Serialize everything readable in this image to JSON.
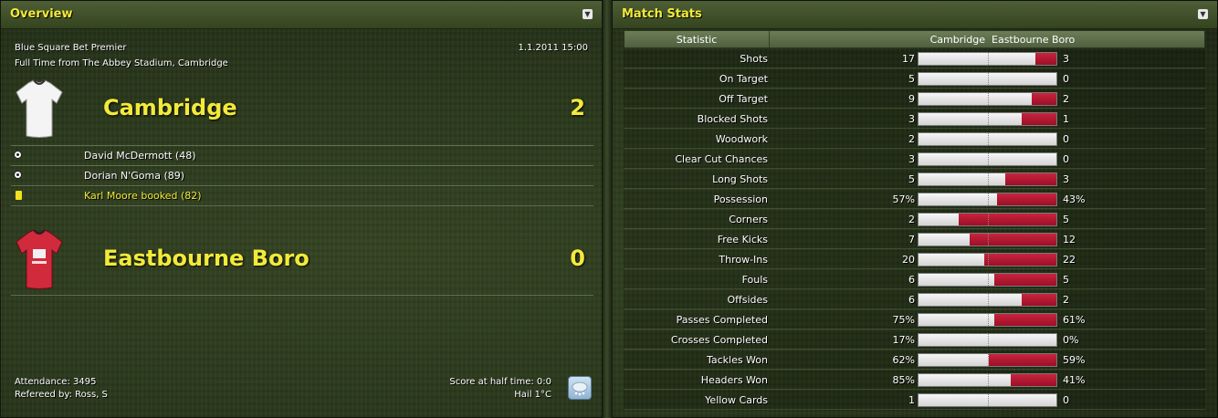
{
  "overview": {
    "title": "Overview",
    "competition": "Blue Square Bet Premier",
    "datetime": "1.1.2011 15:00",
    "venue": "Full Time from The Abbey Stadium, Cambridge",
    "home": {
      "name": "Cambridge",
      "score": "2",
      "shirt_color": "#ffffff"
    },
    "away": {
      "name": "Eastbourne Boro",
      "score": "0",
      "shirt_color": "#d4283a"
    },
    "events": [
      {
        "icon": "ball-icon",
        "text": "David McDermott (48)",
        "color": "#ffffff"
      },
      {
        "icon": "ball-icon",
        "text": "Dorian N'Goma (89)",
        "color": "#ffffff"
      },
      {
        "icon": "yellow-card-icon",
        "text": "Karl Moore booked (82)",
        "color": "#f2ea3a"
      }
    ],
    "attendance": "Attendance: 3495",
    "referee": "Refereed by: Ross, S",
    "halftime": "Score at half time: 0:0",
    "weather": "Hail 1°C",
    "weather_icon": "hail-icon"
  },
  "stats": {
    "title": "Match Stats",
    "header": {
      "statistic": "Statistic",
      "home": "Cambridge",
      "away": "Eastbourne Boro"
    },
    "rows": [
      {
        "label": "Shots",
        "home": "17",
        "away": "3",
        "home_frac": 0.85
      },
      {
        "label": "On Target",
        "home": "5",
        "away": "0",
        "home_frac": 1.0
      },
      {
        "label": "Off Target",
        "home": "9",
        "away": "2",
        "home_frac": 0.82
      },
      {
        "label": "Blocked Shots",
        "home": "3",
        "away": "1",
        "home_frac": 0.75
      },
      {
        "label": "Woodwork",
        "home": "2",
        "away": "0",
        "home_frac": 1.0
      },
      {
        "label": "Clear Cut Chances",
        "home": "3",
        "away": "0",
        "home_frac": 1.0
      },
      {
        "label": "Long Shots",
        "home": "5",
        "away": "3",
        "home_frac": 0.63
      },
      {
        "label": "Possession",
        "home": "57%",
        "away": "43%",
        "home_frac": 0.57
      },
      {
        "label": "Corners",
        "home": "2",
        "away": "5",
        "home_frac": 0.29
      },
      {
        "label": "Free Kicks",
        "home": "7",
        "away": "12",
        "home_frac": 0.37
      },
      {
        "label": "Throw-Ins",
        "home": "20",
        "away": "22",
        "home_frac": 0.48
      },
      {
        "label": "Fouls",
        "home": "6",
        "away": "5",
        "home_frac": 0.55
      },
      {
        "label": "Offsides",
        "home": "6",
        "away": "2",
        "home_frac": 0.75
      },
      {
        "label": "Passes Completed",
        "home": "75%",
        "away": "61%",
        "home_frac": 0.55
      },
      {
        "label": "Crosses Completed",
        "home": "17%",
        "away": "0%",
        "home_frac": 1.0
      },
      {
        "label": "Tackles Won",
        "home": "62%",
        "away": "59%",
        "home_frac": 0.51
      },
      {
        "label": "Headers Won",
        "home": "85%",
        "away": "41%",
        "home_frac": 0.67
      },
      {
        "label": "Yellow Cards",
        "home": "1",
        "away": "0",
        "home_frac": 1.0
      }
    ]
  }
}
